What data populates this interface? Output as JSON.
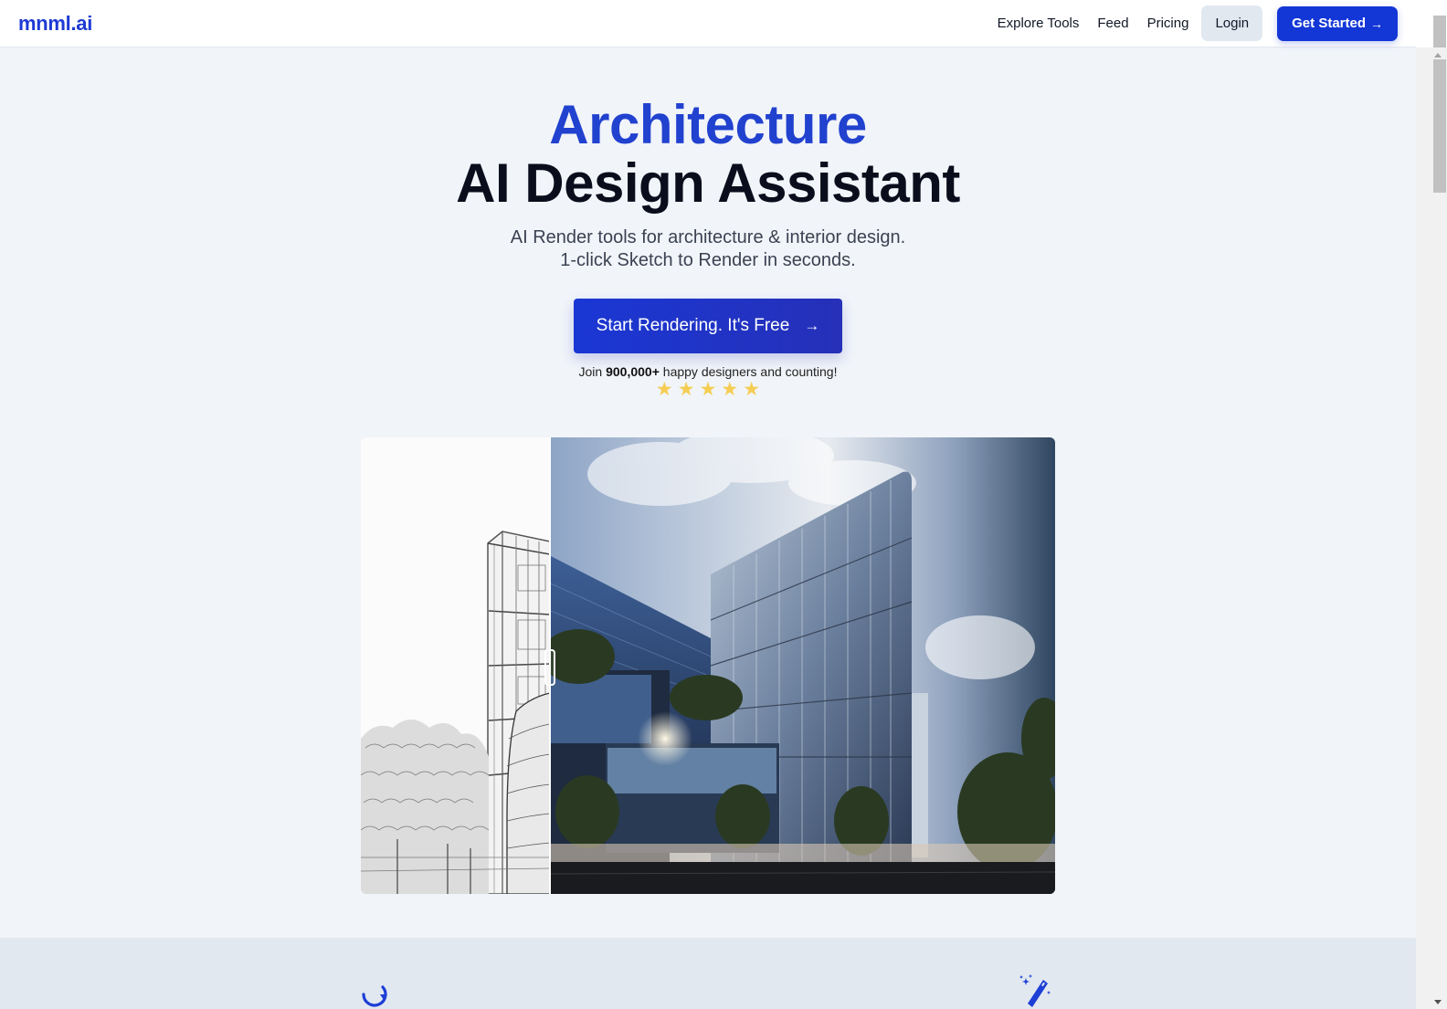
{
  "nav": {
    "logo": "mnml.ai",
    "links": [
      "Explore Tools",
      "Feed",
      "Pricing"
    ],
    "login_label": "Login",
    "get_started_label": "Get Started",
    "get_started_icon": "→"
  },
  "hero": {
    "title_accent": "Architecture",
    "title_main": "AI Design Assistant",
    "subtitle_line1": "AI Render tools for architecture & interior design.",
    "subtitle_line2": "1-click Sketch to Render in seconds.",
    "cta_label": "Start Rendering. It's Free",
    "cta_icon": "→",
    "social_proof_prefix": "Join ",
    "social_proof_count": "900,000+",
    "social_proof_suffix": " happy designers and counting!",
    "rating_stars": 5,
    "star_glyph": "★"
  },
  "compare": {
    "before_label": "sketch",
    "after_label": "render",
    "slider_position": 0.27
  },
  "features": {
    "icons": [
      "refresh-icon",
      "magic-wand-icon"
    ]
  },
  "colors": {
    "brand": "#1336d6",
    "accent_title": "#2141cf",
    "star": "#f5cd52",
    "page_bg": "#f1f4f9",
    "section_bg": "#e2e8f0"
  }
}
